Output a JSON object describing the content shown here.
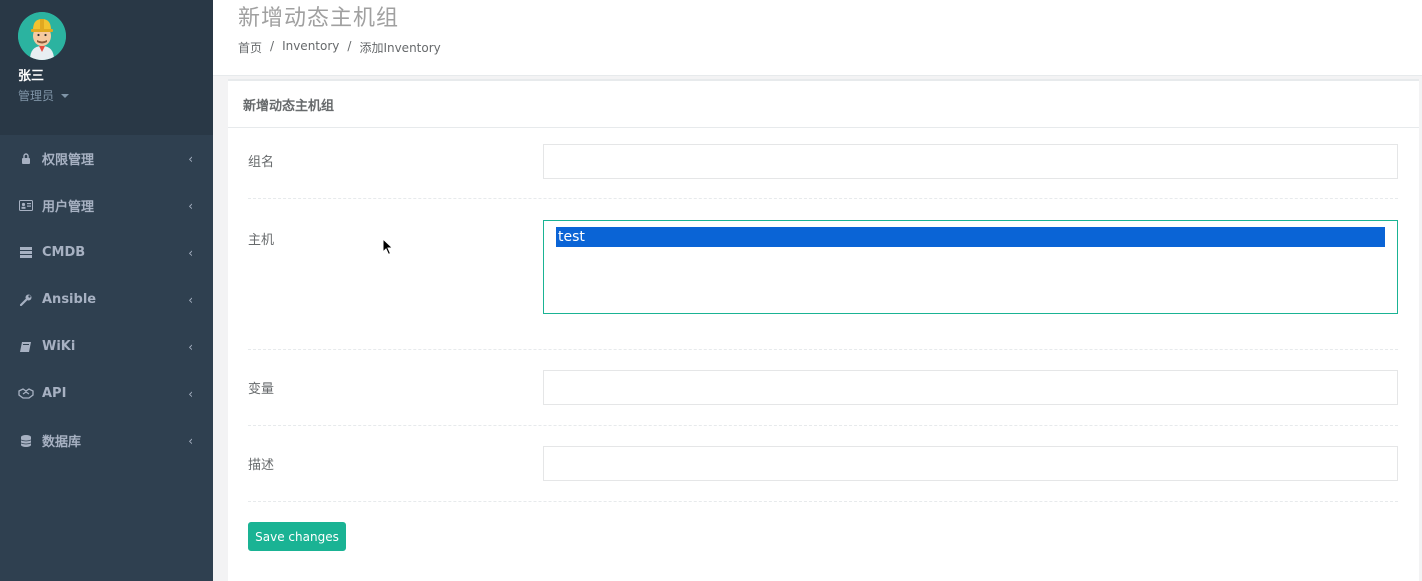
{
  "sidebar": {
    "profile": {
      "name": "张三",
      "role": "管理员"
    },
    "items": [
      {
        "label": "权限管理",
        "icon": "lock-icon"
      },
      {
        "label": "用户管理",
        "icon": "id-card-icon"
      },
      {
        "label": "CMDB",
        "icon": "server-icon"
      },
      {
        "label": "Ansible",
        "icon": "wrench-icon"
      },
      {
        "label": "WiKi",
        "icon": "book-icon"
      },
      {
        "label": "API",
        "icon": "handshake-icon"
      },
      {
        "label": "数据库",
        "icon": "database-icon"
      }
    ],
    "chevron": "‹"
  },
  "header": {
    "title": "新增动态主机组",
    "breadcrumb": [
      "首页",
      "Inventory",
      "添加Inventory"
    ],
    "separator": "/"
  },
  "form": {
    "title": "新增动态主机组",
    "fields": {
      "group_name": {
        "label": "组名",
        "value": ""
      },
      "hosts": {
        "label": "主机",
        "options": [
          "test"
        ],
        "selected": "test"
      },
      "variables": {
        "label": "变量",
        "value": ""
      },
      "description": {
        "label": "描述",
        "value": ""
      }
    },
    "submit_label": "Save changes"
  },
  "colors": {
    "sidebar_bg": "#2f4050",
    "profile_bg": "#293846",
    "accent": "#1ab394",
    "selection": "#0a64d6"
  }
}
